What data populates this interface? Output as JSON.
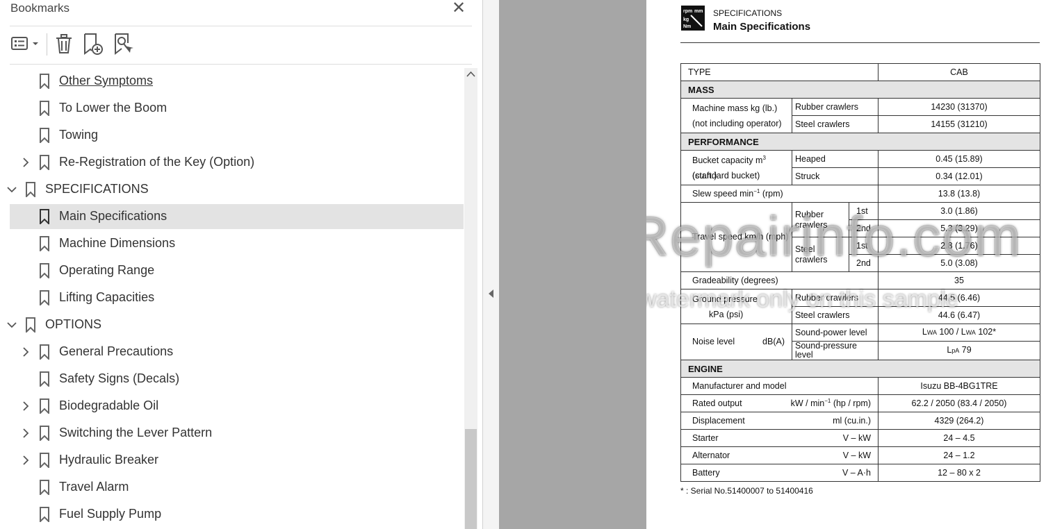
{
  "bookmarks_panel": {
    "title": "Bookmarks",
    "close_glyph": "✕",
    "toolbar": [
      "options-menu-icon",
      "delete-icon",
      "new-bookmark-icon",
      "find-current-bookmark-icon"
    ],
    "items": [
      {
        "label": "Other Symptoms",
        "expandable": false,
        "level": 2
      },
      {
        "label": "To Lower the Boom",
        "expandable": false,
        "level": 2
      },
      {
        "label": "Towing",
        "expandable": false,
        "level": 2
      },
      {
        "label": "Re-Registration of the Key (Option)",
        "expandable": true,
        "expanded": false,
        "level": 2
      },
      {
        "label": "SPECIFICATIONS",
        "expandable": true,
        "expanded": true,
        "level": 1
      },
      {
        "label": "Main Specifications",
        "expandable": false,
        "level": 2,
        "selected": true
      },
      {
        "label": "Machine Dimensions",
        "expandable": false,
        "level": 2
      },
      {
        "label": "Operating Range",
        "expandable": false,
        "level": 2
      },
      {
        "label": "Lifting Capacities",
        "expandable": false,
        "level": 2
      },
      {
        "label": "OPTIONS",
        "expandable": true,
        "expanded": true,
        "level": 1
      },
      {
        "label": "General Precautions",
        "expandable": true,
        "expanded": false,
        "level": 2
      },
      {
        "label": "Safety Signs (Decals)",
        "expandable": false,
        "level": 2
      },
      {
        "label": "Biodegradable Oil",
        "expandable": true,
        "expanded": false,
        "level": 2
      },
      {
        "label": "Switching the Lever Pattern",
        "expandable": true,
        "expanded": false,
        "level": 2
      },
      {
        "label": "Hydraulic Breaker",
        "expandable": true,
        "expanded": false,
        "level": 2
      },
      {
        "label": "Travel Alarm",
        "expandable": false,
        "level": 2
      },
      {
        "label": "Fuel Supply Pump",
        "expandable": false,
        "level": 2
      }
    ]
  },
  "document": {
    "section": "SPECIFICATIONS",
    "title": "Main Specifications",
    "icon_lines": [
      "rpm",
      "mm",
      "kg",
      "Nm"
    ],
    "table": {
      "type_label": "TYPE",
      "type_value": "CAB",
      "mass_header": "MASS",
      "machine_mass_label_1": "Machine mass  kg (lb.)",
      "machine_mass_label_2": "(not including operator)",
      "rubber_crawlers": "Rubber crawlers",
      "steel_crawlers": "Steel crawlers",
      "mass_rubber": "14230 (31370)",
      "mass_steel": "14155 (31210)",
      "performance_header": "PERFORMANCE",
      "bucket_label_pre": "Bucket capacity m",
      "bucket_label_sup": "3",
      "bucket_label_post": " (cu.ft.)",
      "bucket_label_2": "(standard bucket)",
      "heaped": "Heaped",
      "struck": "Struck",
      "heaped_value": "0.45 (15.89)",
      "struck_value": "0.34 (12.01)",
      "slew_label_pre": "Slew speed  min",
      "slew_label_sup": "−1",
      "slew_label_post": " (rpm)",
      "slew_value": "13.8 (13.8)",
      "travel_label": "Travel speed km/h (mph)",
      "travel_rubber": "Rubber crawlers",
      "travel_steel": "Steel crawlers",
      "first": "1st",
      "second": "2nd",
      "travel_rubber_1": "3.0 (1.86)",
      "travel_rubber_2": "5.3 (3.29)",
      "travel_steel_1": "2.8 (1.76)",
      "travel_steel_2": "5.0 (3.08)",
      "gradeability_label": "Gradeability (degrees)",
      "gradeability_value": "35",
      "ground_pressure_label_1": "Ground pressure",
      "ground_pressure_label_2": "kPa (psi)",
      "gp_rubber": "44.5 (6.46)",
      "gp_steel": "44.6 (6.47)",
      "noise_label": "Noise level",
      "noise_unit": "dB(A)",
      "sound_power": "Sound-power level",
      "sound_pressure": "Sound-pressure level",
      "lwa_l": "L",
      "lwa_sub": "WA",
      "sound_power_v1": " 100 / ",
      "sound_power_v2": " 102*",
      "lpa_sub": "pA",
      "sound_pressure_v": " 79",
      "engine_header": "ENGINE",
      "manufacturer_label": "Manufacturer and model",
      "manufacturer_value": "Isuzu BB-4BG1TRE",
      "rated_output_label": "Rated output",
      "rated_output_unit_pre": "kW / min",
      "rated_output_unit_sup": "−1",
      "rated_output_unit_post": " (hp / rpm)",
      "rated_output_value": "62.2 / 2050 (83.4 / 2050)",
      "displacement_label": "Displacement",
      "displacement_unit": "ml (cu.in.)",
      "displacement_value": "4329 (264.2)",
      "starter_label": "Starter",
      "starter_unit": "V – kW",
      "starter_value": "24 – 4.5",
      "alternator_label": "Alternator",
      "alternator_unit": "V – kW",
      "alternator_value": "24 – 1.2",
      "battery_label": "Battery",
      "battery_unit": "V – A·h",
      "battery_value": "12 – 80 x 2"
    },
    "footnote": "* : Serial No.51400007 to 51400416",
    "watermark_1": "eRepairinfo.com",
    "watermark_2": "watermark only on this sample"
  }
}
